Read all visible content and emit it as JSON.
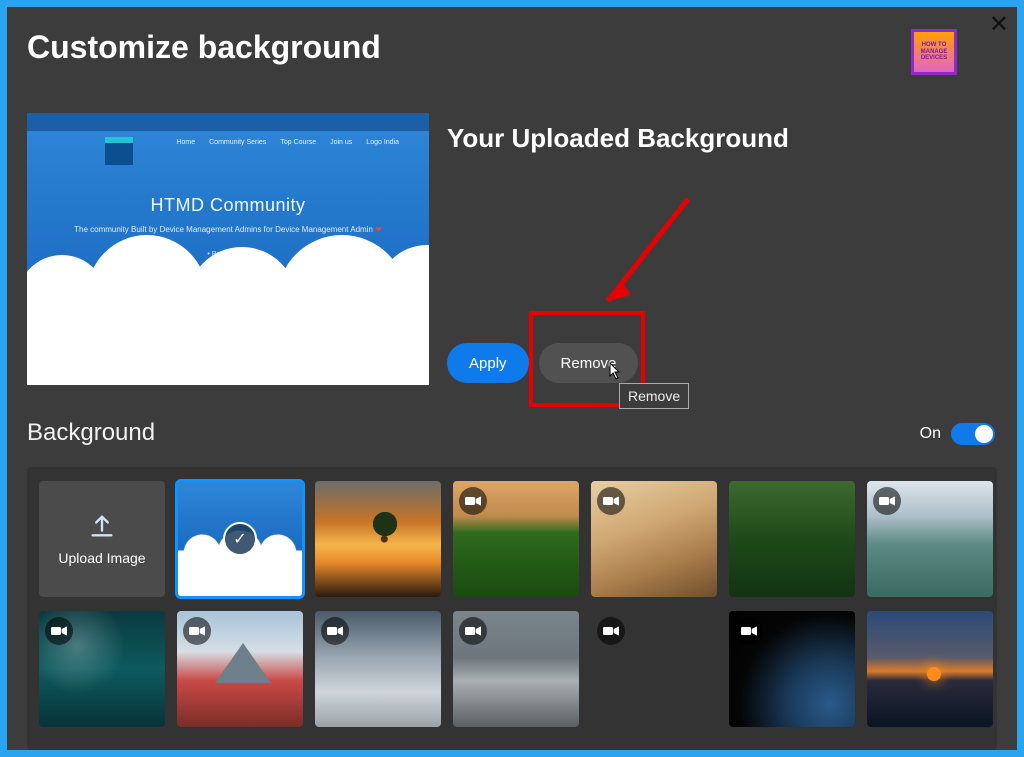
{
  "header": {
    "title": "Customize background"
  },
  "logo": {
    "line1": "HOW TO",
    "line2": "MANAGE",
    "line3": "DEVICES"
  },
  "uploaded": {
    "section_title": "Your Uploaded Background",
    "preview": {
      "nav": [
        "Home",
        "Community Series",
        "Top Course",
        "Join us",
        "Logo India"
      ],
      "title": "HTMD Community",
      "subtitle_pre": "The community Built by Device Management Admins for Device Management Admin",
      "subtitle_icon": "❤",
      "powered": "• Powered by"
    },
    "apply_label": "Apply",
    "remove_label": "Remove",
    "tooltip": "Remove"
  },
  "background_section": {
    "title": "Background",
    "toggle_label": "On",
    "toggle_state": true
  },
  "upload_tile": {
    "label": "Upload Image"
  },
  "tiles_row1": [
    {
      "id": "current",
      "selected": true,
      "video": false,
      "cls": "bg-sel"
    },
    {
      "id": "sunset-tree",
      "selected": false,
      "video": false,
      "cls": "bg-sunset-tree"
    },
    {
      "id": "fields",
      "selected": false,
      "video": true,
      "cls": "bg-fields"
    },
    {
      "id": "desert",
      "selected": false,
      "video": true,
      "cls": "bg-desert"
    },
    {
      "id": "forest",
      "selected": false,
      "video": false,
      "cls": "bg-forest"
    },
    {
      "id": "lake",
      "selected": false,
      "video": true,
      "cls": "bg-lake"
    }
  ],
  "tiles_row2": [
    {
      "id": "ocean",
      "video": true,
      "cls": "bg-ocean"
    },
    {
      "id": "fuji",
      "video": true,
      "cls": "bg-fuji"
    },
    {
      "id": "mist",
      "video": true,
      "cls": "bg-mist"
    },
    {
      "id": "island",
      "video": true,
      "cls": "bg-island"
    },
    {
      "id": "city",
      "video": true,
      "cls": "bg-city"
    },
    {
      "id": "earth",
      "video": true,
      "cls": "bg-earth"
    },
    {
      "id": "ocean-sunset",
      "video": false,
      "cls": "bg-ocean-sunset"
    }
  ]
}
